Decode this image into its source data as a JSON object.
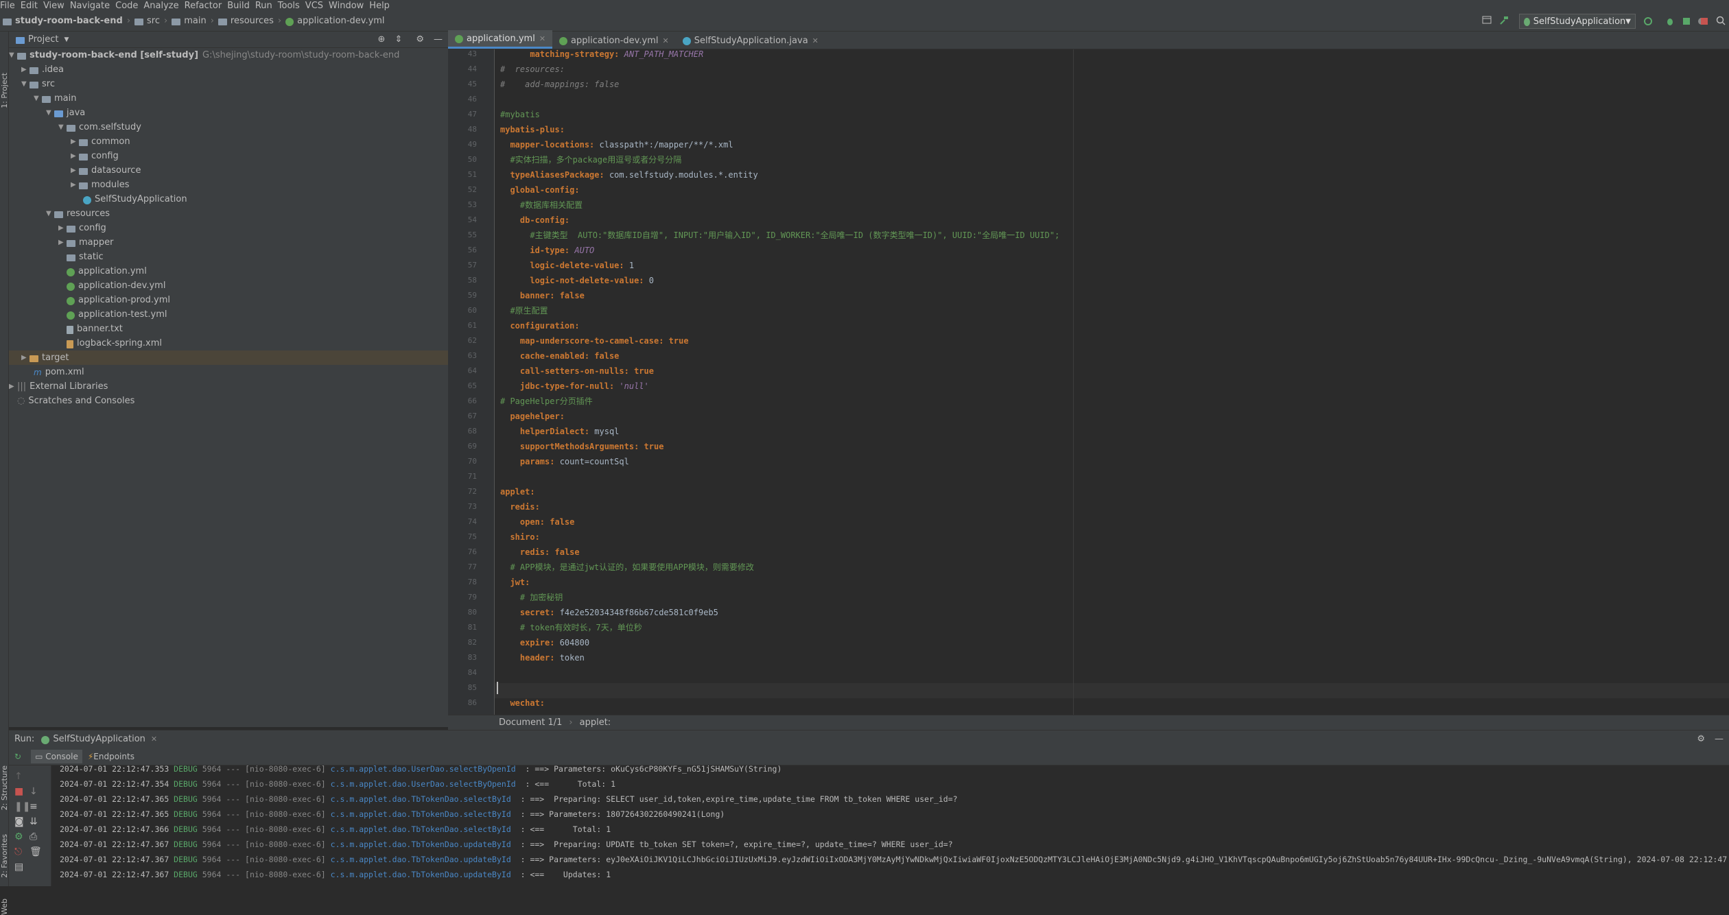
{
  "menu": [
    "File",
    "Edit",
    "View",
    "Navigate",
    "Code",
    "Analyze",
    "Refactor",
    "Build",
    "Run",
    "Tools",
    "VCS",
    "Window",
    "Help"
  ],
  "breadcrumb": [
    "study-room-back-end",
    "src",
    "main",
    "resources",
    "application-dev.yml"
  ],
  "run_config": "SelfStudyApplication",
  "project_panel": {
    "title": "Project",
    "root_name": "study-room-back-end [self-study]",
    "root_path": "G:\\shejing\\study-room\\study-room-back-end",
    "items": [
      ".idea",
      "src",
      "main",
      "java",
      "com.selfstudy",
      "common",
      "config",
      "datasource",
      "modules",
      "SelfStudyApplication",
      "resources",
      "config",
      "mapper",
      "static",
      "application.yml",
      "application-dev.yml",
      "application-prod.yml",
      "application-test.yml",
      "banner.txt",
      "logback-spring.xml",
      "target",
      "pom.xml",
      "External Libraries",
      "Scratches and Consoles"
    ]
  },
  "left_strip": [
    "1: Project",
    "2: Structure",
    "2: Favorites",
    "Web"
  ],
  "tabs": [
    "application.yml",
    "application-dev.yml",
    "SelfStudyApplication.java"
  ],
  "code_lines": [
    {
      "n": "43",
      "t": "      matching-strategy: ANT_PATH_MATCHER"
    },
    {
      "n": "44",
      "t": "#  resources:"
    },
    {
      "n": "45",
      "t": "#    add-mappings: false"
    },
    {
      "n": "46",
      "t": ""
    },
    {
      "n": "47",
      "t": "#mybatis"
    },
    {
      "n": "48",
      "t": "mybatis-plus:"
    },
    {
      "n": "49",
      "t": "  mapper-locations: classpath*:/mapper/**/*.xml"
    },
    {
      "n": "50",
      "t": "  #实体扫描，多个package用逗号或者分号分隔"
    },
    {
      "n": "51",
      "t": "  typeAliasesPackage: com.selfstudy.modules.*.entity"
    },
    {
      "n": "52",
      "t": "  global-config:"
    },
    {
      "n": "53",
      "t": "    #数据库相关配置"
    },
    {
      "n": "54",
      "t": "    db-config:"
    },
    {
      "n": "55",
      "t": "      #主键类型  AUTO:\"数据库ID自增\", INPUT:\"用户输入ID\", ID_WORKER:\"全局唯一ID (数字类型唯一ID)\", UUID:\"全局唯一ID UUID\";"
    },
    {
      "n": "56",
      "t": "      id-type: AUTO"
    },
    {
      "n": "57",
      "t": "      logic-delete-value: 1"
    },
    {
      "n": "58",
      "t": "      logic-not-delete-value: 0"
    },
    {
      "n": "59",
      "t": "    banner: false"
    },
    {
      "n": "60",
      "t": "  #原生配置"
    },
    {
      "n": "61",
      "t": "  configuration:"
    },
    {
      "n": "62",
      "t": "    map-underscore-to-camel-case: true"
    },
    {
      "n": "63",
      "t": "    cache-enabled: false"
    },
    {
      "n": "64",
      "t": "    call-setters-on-nulls: true"
    },
    {
      "n": "65",
      "t": "    jdbc-type-for-null: 'null'"
    },
    {
      "n": "66",
      "t": "# PageHelper分页插件"
    },
    {
      "n": "67",
      "t": "  pagehelper:"
    },
    {
      "n": "68",
      "t": "    helperDialect: mysql"
    },
    {
      "n": "69",
      "t": "    supportMethodsArguments: true"
    },
    {
      "n": "70",
      "t": "    params: count=countSql"
    },
    {
      "n": "71",
      "t": ""
    },
    {
      "n": "72",
      "t": "applet:"
    },
    {
      "n": "73",
      "t": "  redis:"
    },
    {
      "n": "74",
      "t": "    open: false"
    },
    {
      "n": "75",
      "t": "  shiro:"
    },
    {
      "n": "76",
      "t": "    redis: false"
    },
    {
      "n": "77",
      "t": "  # APP模块，是通过jwt认证的，如果要使用APP模块，则需要修改"
    },
    {
      "n": "78",
      "t": "  jwt:"
    },
    {
      "n": "79",
      "t": "    # 加密秘钥"
    },
    {
      "n": "80",
      "t": "    secret: f4e2e52034348f86b67cde581c0f9eb5"
    },
    {
      "n": "81",
      "t": "    # token有效时长，7天，单位秒"
    },
    {
      "n": "82",
      "t": "    expire: 604800"
    },
    {
      "n": "83",
      "t": "    header: token"
    },
    {
      "n": "84",
      "t": ""
    },
    {
      "n": "85",
      "t": ""
    },
    {
      "n": "86",
      "t": "  wechat:"
    }
  ],
  "editor_breadcrumb": [
    "Document 1/1",
    "applet:"
  ],
  "run_panel": {
    "label": "Run:",
    "config_tab": "SelfStudyApplication",
    "tabs": [
      "Console",
      "Endpoints"
    ],
    "log_lines": [
      {
        "ts": "2024-07-01 22:12:47.353",
        "lvl": "DEBUG",
        "pid": "5964",
        "th": "--- [nio-8080-exec-6]",
        "logger": "c.s.m.applet.dao.UserDao.selectByOpenId",
        "msg": " : ==> Parameters: oKuCys6cP80KYFs_nG51jSHAMSuY(String)"
      },
      {
        "ts": "2024-07-01 22:12:47.354",
        "lvl": "DEBUG",
        "pid": "5964",
        "th": "--- [nio-8080-exec-6]",
        "logger": "c.s.m.applet.dao.UserDao.selectByOpenId",
        "msg": " : <==      Total: 1"
      },
      {
        "ts": "2024-07-01 22:12:47.365",
        "lvl": "DEBUG",
        "pid": "5964",
        "th": "--- [nio-8080-exec-6]",
        "logger": "c.s.m.applet.dao.TbTokenDao.selectById",
        "msg": " : ==>  Preparing: SELECT user_id,token,expire_time,update_time FROM tb_token WHERE user_id=?"
      },
      {
        "ts": "2024-07-01 22:12:47.365",
        "lvl": "DEBUG",
        "pid": "5964",
        "th": "--- [nio-8080-exec-6]",
        "logger": "c.s.m.applet.dao.TbTokenDao.selectById",
        "msg": " : ==> Parameters: 1807264302260490241(Long)"
      },
      {
        "ts": "2024-07-01 22:12:47.366",
        "lvl": "DEBUG",
        "pid": "5964",
        "th": "--- [nio-8080-exec-6]",
        "logger": "c.s.m.applet.dao.TbTokenDao.selectById",
        "msg": " : <==      Total: 1"
      },
      {
        "ts": "2024-07-01 22:12:47.367",
        "lvl": "DEBUG",
        "pid": "5964",
        "th": "--- [nio-8080-exec-6]",
        "logger": "c.s.m.applet.dao.TbTokenDao.updateById",
        "msg": " : ==>  Preparing: UPDATE tb_token SET token=?, expire_time=?, update_time=? WHERE user_id=?"
      },
      {
        "ts": "2024-07-01 22:12:47.367",
        "lvl": "DEBUG",
        "pid": "5964",
        "th": "--- [nio-8080-exec-6]",
        "logger": "c.s.m.applet.dao.TbTokenDao.updateById",
        "msg": " : ==> Parameters: eyJ0eXAiOiJKV1QiLCJhbGciOiJIUzUxMiJ9.eyJzdWIiOiIxODA3MjY0MzAyMjYwNDkwMjQxIiwiaWF0IjoxNzE5ODQzMTY3LCJleHAiOjE3MjA0NDc5Njd9.g4iJHO_V1KhVTqscpQAuBnpo6mUGIy5oj6ZhStUoab5n76y84UUR+IHx-99DcQncu-_Dzing_-9uNVeA9vmqA(String), 2024-07-08 22:12:47.367(Timestamp), 2024-07-01"
      },
      {
        "ts": "2024-07-01 22:12:47.367",
        "lvl": "DEBUG",
        "pid": "5964",
        "th": "--- [nio-8080-exec-6]",
        "logger": "c.s.m.applet.dao.TbTokenDao.updateById",
        "msg": " : <==    Updates: 1"
      }
    ]
  },
  "colors": {
    "accent": "#4a88c7",
    "keyword": "#cc7832",
    "comment": "#629755",
    "bg": "#2b2b2b",
    "panel": "#3c3f41"
  }
}
